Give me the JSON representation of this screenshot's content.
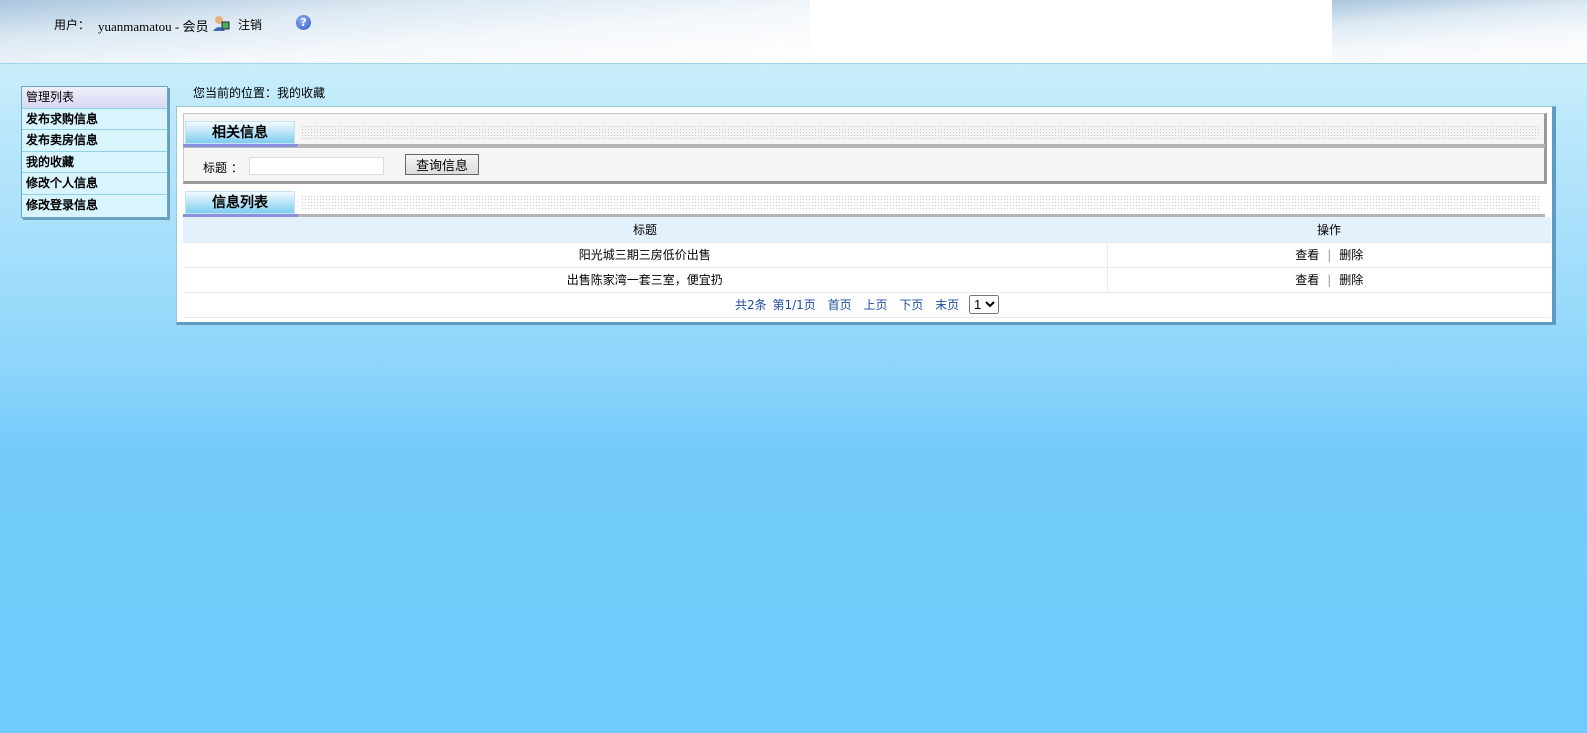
{
  "header": {
    "user_label": "用户：",
    "username": "yuanmamatou - 会员",
    "logout": "注销",
    "help_icon": "question-icon",
    "user_icon": "user-icon"
  },
  "sidebar": {
    "items": [
      "管理列表",
      "发布求购信息",
      "发布卖房信息",
      "我的收藏",
      "修改个人信息",
      "修改登录信息"
    ]
  },
  "breadcrumb": "您当前的位置：我的收藏",
  "search_section": {
    "title": "相关信息",
    "label": "标题 ：",
    "value": "",
    "button": "查询信息"
  },
  "list_section": {
    "title": "信息列表",
    "columns": [
      "标题",
      "操作"
    ],
    "rows": [
      {
        "title": "阳光城三期三房低价出售",
        "view": "查看",
        "sep": "|",
        "delete": "删除"
      },
      {
        "title": "出售陈家湾一套三室，便宜扔",
        "view": "查看",
        "sep": "|",
        "delete": "删除"
      }
    ]
  },
  "pager": {
    "total": "共2条",
    "page": "第1/1页",
    "first": "首页",
    "prev": "上页",
    "next": "下页",
    "last": "末页",
    "selected": "1"
  }
}
